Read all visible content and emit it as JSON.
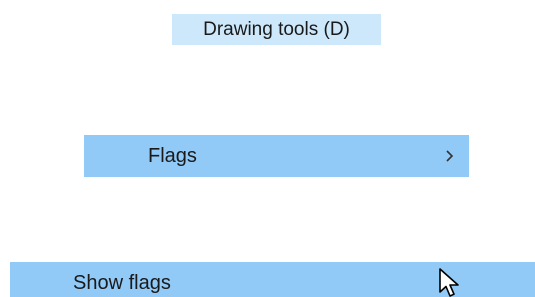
{
  "tooltip": {
    "text": "Drawing tools (D)"
  },
  "menu": {
    "flags": {
      "label": "Flags",
      "submenu_icon": "chevron-right-icon"
    },
    "show_flags": {
      "label": "Show flags"
    }
  },
  "cursor": {
    "icon": "mouse-pointer-icon"
  },
  "colors": {
    "tooltip_background": "#cde8fb",
    "menu_highlight": "#91c9f7",
    "text": "#1a1a1a"
  }
}
